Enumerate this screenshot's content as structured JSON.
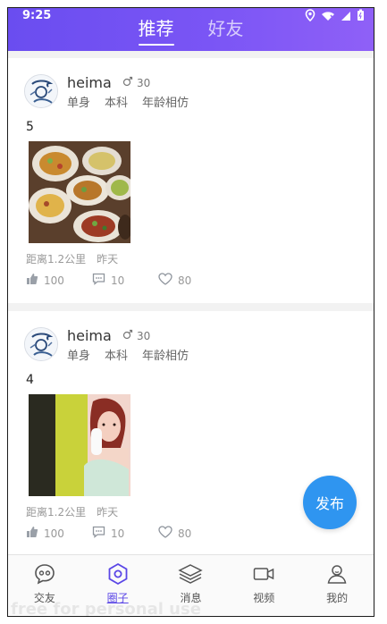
{
  "status_bar": {
    "time": "9:25"
  },
  "header": {
    "tabs": [
      {
        "label": "推荐",
        "active": true
      },
      {
        "label": "好友",
        "active": false
      }
    ],
    "accent": "#6a4df0"
  },
  "posts": [
    {
      "username": "heima",
      "gender_icon": "male-icon",
      "age": "30",
      "tags": [
        "单身",
        "本科",
        "年龄相仿"
      ],
      "text": "5",
      "photo": "food-photo",
      "distance": "距离1.2公里",
      "time": "昨天",
      "likes": "100",
      "comments": "10",
      "favorites": "80"
    },
    {
      "username": "heima",
      "gender_icon": "male-icon",
      "age": "30",
      "tags": [
        "单身",
        "本科",
        "年龄相仿"
      ],
      "text": "4",
      "photo": "portrait-photo",
      "distance": "距离1.2公里",
      "time": "昨天",
      "likes": "100",
      "comments": "10",
      "favorites": "80"
    }
  ],
  "fab": {
    "label": "发布",
    "color": "#2f95f0"
  },
  "bottom_nav": [
    {
      "label": "交友",
      "icon": "chat-bubble-icon",
      "active": false
    },
    {
      "label": "圈子",
      "icon": "hexagon-icon",
      "active": true
    },
    {
      "label": "消息",
      "icon": "layers-icon",
      "active": false
    },
    {
      "label": "视频",
      "icon": "video-icon",
      "active": false
    },
    {
      "label": "我的",
      "icon": "user-icon",
      "active": false
    }
  ],
  "watermark": "free for personal use"
}
